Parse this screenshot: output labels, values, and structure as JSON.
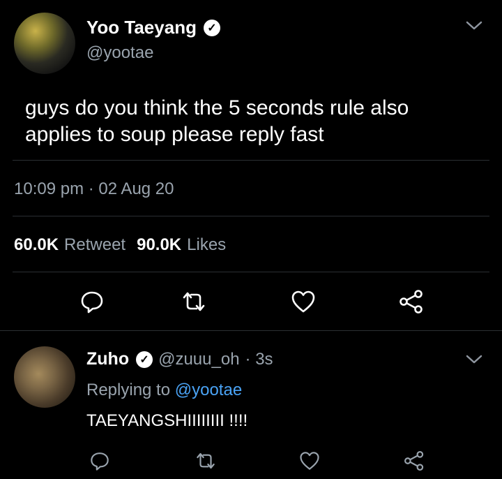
{
  "tweet": {
    "author_name": "Yoo Taeyang",
    "author_handle": "@yootae",
    "text_line1": "guys do you think the 5 seconds rule also",
    "text_line2": "applies to soup please reply fast",
    "timestamp": "10:09 pm · 02 Aug 20",
    "retweets_count": "60.0K",
    "retweets_label": "Retweet",
    "likes_count": "90.0K",
    "likes_label": "Likes"
  },
  "reply": {
    "author_name": "Zuho",
    "author_handle": "@zuuu_oh",
    "age": "· 3s",
    "replying_to_prefix": "Replying to",
    "replying_to_handle": "@yootae",
    "text": "TAEYANGSHIIIIIIII !!!!"
  },
  "icons": {
    "reply": "reply-icon",
    "retweet": "retweet-icon",
    "like": "heart-icon",
    "share": "share-icon",
    "menu": "chevron-down-icon",
    "verified": "verified-badge-icon"
  },
  "colors": {
    "background": "#000000",
    "muted_text": "#9aa4ae",
    "link": "#4aa3f5",
    "divider": "#2b2f33"
  }
}
